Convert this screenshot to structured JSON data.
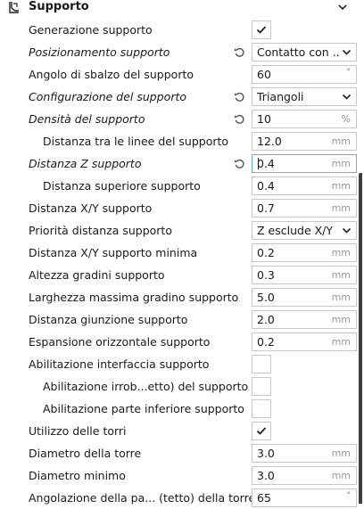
{
  "section": {
    "title": "Supporto",
    "icon": "support-icon",
    "collapse_icon": "chevron-down-icon"
  },
  "settings": [
    {
      "label": "Generazione supporto",
      "type": "checkbox",
      "checked": true
    },
    {
      "label": "Posizionamento supporto",
      "type": "select",
      "value": "Contatto con ...",
      "italic": true,
      "reset": true
    },
    {
      "label": "Angolo di sbalzo del supporto",
      "type": "input",
      "value": "60",
      "unit": "°"
    },
    {
      "label": "Configurazione del supporto",
      "type": "select",
      "value": "Triangoli",
      "italic": true,
      "reset": true
    },
    {
      "label": "Densità del supporto",
      "type": "input",
      "value": "10",
      "unit": "%",
      "italic": true,
      "reset": true
    },
    {
      "label": "Distanza tra le linee del supporto",
      "type": "input",
      "value": "12.0",
      "unit": "mm",
      "indent": true
    },
    {
      "label": "Distanza Z supporto",
      "type": "input",
      "value": "0.4",
      "unit": "mm",
      "italic": true,
      "reset": true,
      "active": true
    },
    {
      "label": "Distanza superiore supporto",
      "type": "input",
      "value": "0.4",
      "unit": "mm",
      "indent": true
    },
    {
      "label": "Distanza X/Y supporto",
      "type": "input",
      "value": "0.7",
      "unit": "mm"
    },
    {
      "label": "Priorità distanza supporto",
      "type": "select",
      "value": "Z esclude X/Y"
    },
    {
      "label": "Distanza X/Y supporto minima",
      "type": "input",
      "value": "0.2",
      "unit": "mm"
    },
    {
      "label": "Altezza gradini supporto",
      "type": "input",
      "value": "0.3",
      "unit": "mm"
    },
    {
      "label": "Larghezza massima gradino supporto",
      "type": "input",
      "value": "5.0",
      "unit": "mm"
    },
    {
      "label": "Distanza giunzione supporto",
      "type": "input",
      "value": "2.0",
      "unit": "mm"
    },
    {
      "label": "Espansione orizzontale supporto",
      "type": "input",
      "value": "0.2",
      "unit": "mm"
    },
    {
      "label": "Abilitazione interfaccia supporto",
      "type": "checkbox",
      "checked": false
    },
    {
      "label": "Abilitazione irrob...etto) del supporto",
      "type": "checkbox",
      "checked": false,
      "indent": true
    },
    {
      "label": "Abilitazione parte inferiore supporto",
      "type": "checkbox",
      "checked": false,
      "indent": true
    },
    {
      "label": "Utilizzo delle torri",
      "type": "checkbox",
      "checked": true
    },
    {
      "label": "Diametro della torre",
      "type": "input",
      "value": "3.0",
      "unit": "mm"
    },
    {
      "label": "Diametro minimo",
      "type": "input",
      "value": "3.0",
      "unit": "mm"
    },
    {
      "label": "Angolazione della pa... (tetto) della torre",
      "type": "input",
      "value": "65",
      "unit": "°"
    }
  ],
  "colors": {
    "accent_active": "#5fb1e6",
    "check": "#222222",
    "scrollbar": "#3a3f47"
  }
}
